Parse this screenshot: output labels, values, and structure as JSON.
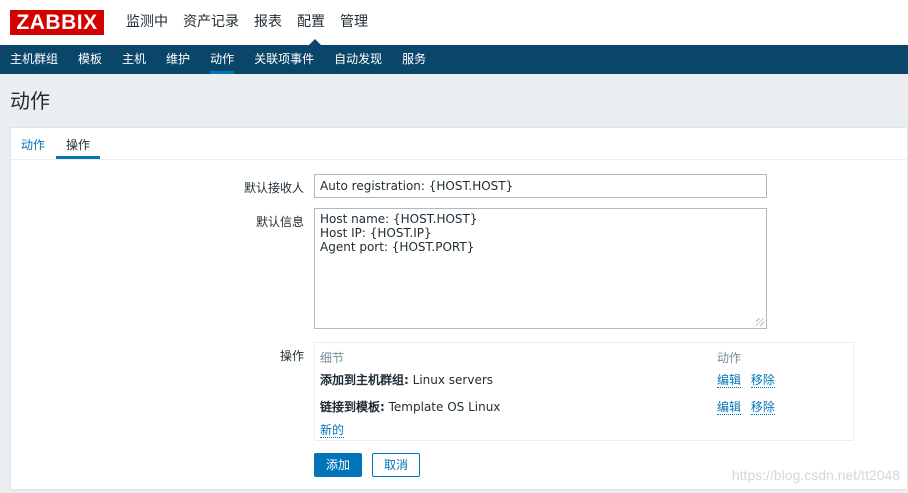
{
  "logo": {
    "text": "ZABBIX"
  },
  "top_nav": {
    "items": [
      {
        "label": "监测中"
      },
      {
        "label": "资产记录"
      },
      {
        "label": "报表"
      },
      {
        "label": "配置"
      },
      {
        "label": "管理"
      }
    ],
    "active_index": 3
  },
  "sub_nav": {
    "items": [
      {
        "label": "主机群组"
      },
      {
        "label": "模板"
      },
      {
        "label": "主机"
      },
      {
        "label": "维护"
      },
      {
        "label": "动作"
      },
      {
        "label": "关联项事件"
      },
      {
        "label": "自动发现"
      },
      {
        "label": "服务"
      }
    ],
    "active_index": 4
  },
  "page": {
    "title": "动作"
  },
  "tabs": [
    {
      "label": "动作"
    },
    {
      "label": "操作"
    }
  ],
  "form": {
    "default_recipient_label": "默认接收人",
    "default_recipient_value": "Auto registration: {HOST.HOST}",
    "default_message_label": "默认信息",
    "default_message_lines": [
      "Host name: {HOST.HOST}",
      "Host IP: {HOST.IP}",
      "Agent port: {HOST.PORT}"
    ],
    "operations_label": "操作"
  },
  "operations": {
    "header_details": "细节",
    "header_actions": "动作",
    "rows": [
      {
        "prefix": "添加到主机群组:",
        "value": " Linux servers",
        "edit": "编辑",
        "remove": "移除"
      },
      {
        "prefix": "链接到模板:",
        "value": " Template OS Linux",
        "edit": "编辑",
        "remove": "移除"
      }
    ],
    "new_link": "新的"
  },
  "buttons": {
    "add": "添加",
    "cancel": "取消"
  },
  "watermark": "https://blog.csdn.net/tt2048",
  "colors": {
    "brand_red": "#d40000",
    "nav_blue": "#0a466a",
    "accent": "#0275b8"
  }
}
